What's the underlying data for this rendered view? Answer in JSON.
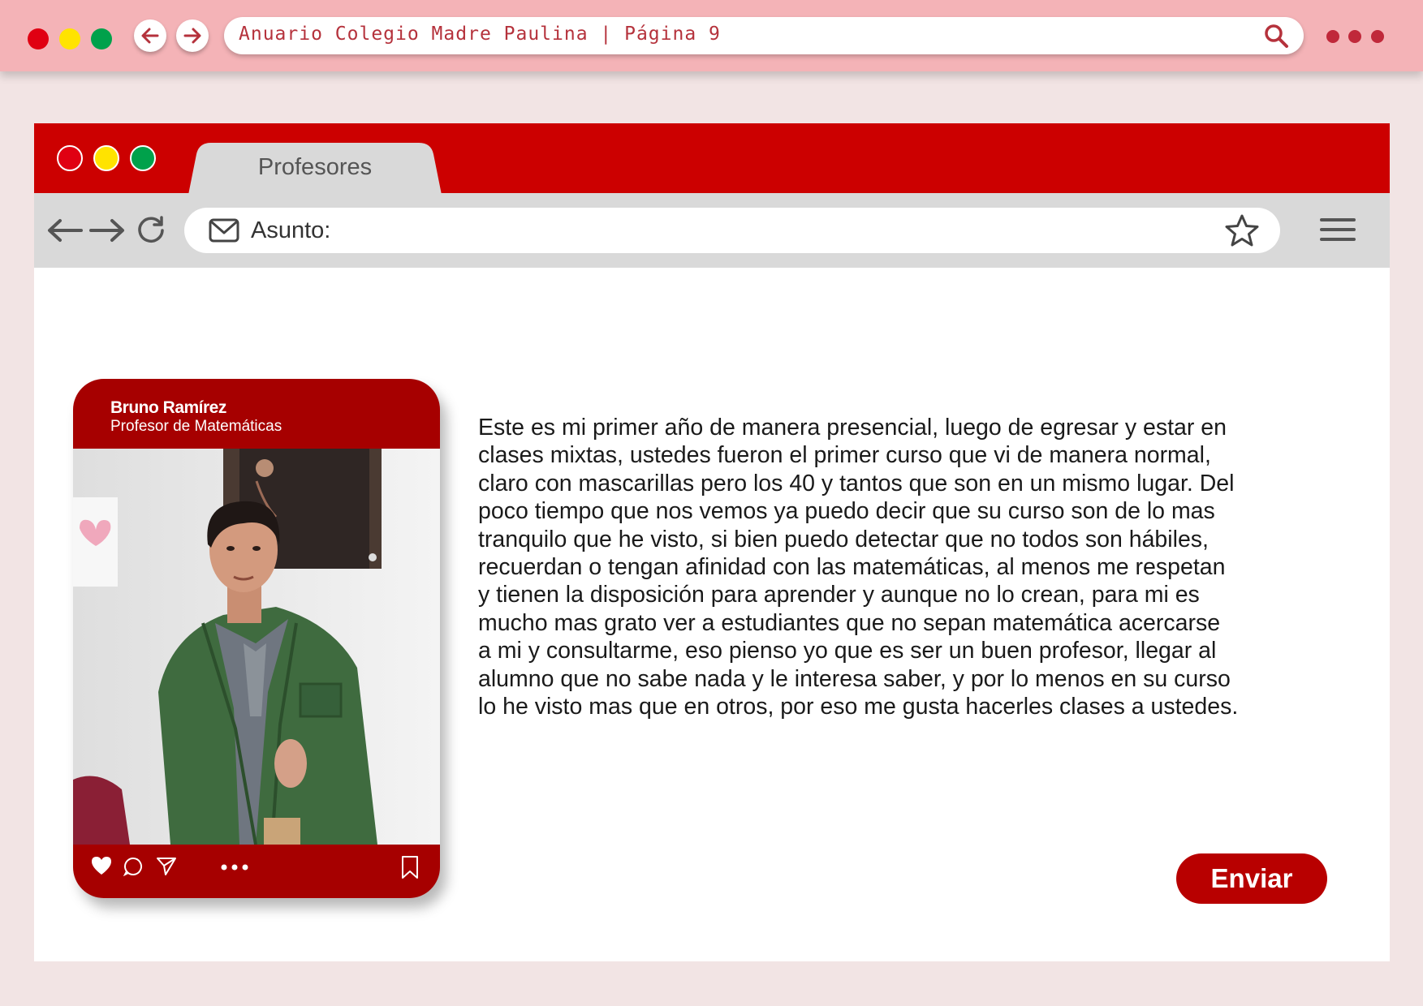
{
  "outer_browser": {
    "url_text": "Anuario Colegio Madre Paulina | Página 9",
    "window_controls": [
      "close",
      "minimize",
      "maximize"
    ],
    "colors": {
      "bar": "#f4b3b7",
      "accent": "#c0283a"
    }
  },
  "window": {
    "tab": {
      "label": "Profesores"
    },
    "address": {
      "label": "Asunto:"
    },
    "colors": {
      "titlebar": "#cc0000",
      "toolbar": "#d9d9d9"
    }
  },
  "post": {
    "name": "Bruno Ramírez",
    "role": "Profesor de Matemáticas",
    "photo": "teacher-photo",
    "actions": [
      "heart-icon",
      "comment-icon",
      "send-icon",
      "more-icon",
      "bookmark-icon"
    ]
  },
  "message": {
    "body": "Este es mi primer año de manera presencial, luego de egresar y estar en\nclases mixtas, ustedes fueron el primer curso que vi de manera normal,\nclaro con mascarillas pero los 40 y tantos que son en un mismo lugar. Del\npoco tiempo que nos vemos ya puedo decir que su curso son de lo mas\ntranquilo que he visto, si bien puedo detectar que no todos son hábiles,\nrecuerdan  o tengan afinidad con las matemáticas, al menos me respetan\ny tienen la disposición para aprender y aunque no lo crean, para mi es\nmucho mas grato ver a estudiantes que no sepan matemática acercarse\na mi y consultarme, eso pienso yo que es ser un buen profesor, llegar al\nalumno que no sabe nada y le interesa saber, y por lo menos en su curso\nlo he visto mas que en otros, por eso me gusta hacerles clases a ustedes."
  },
  "send_button": {
    "label": "Enviar"
  }
}
